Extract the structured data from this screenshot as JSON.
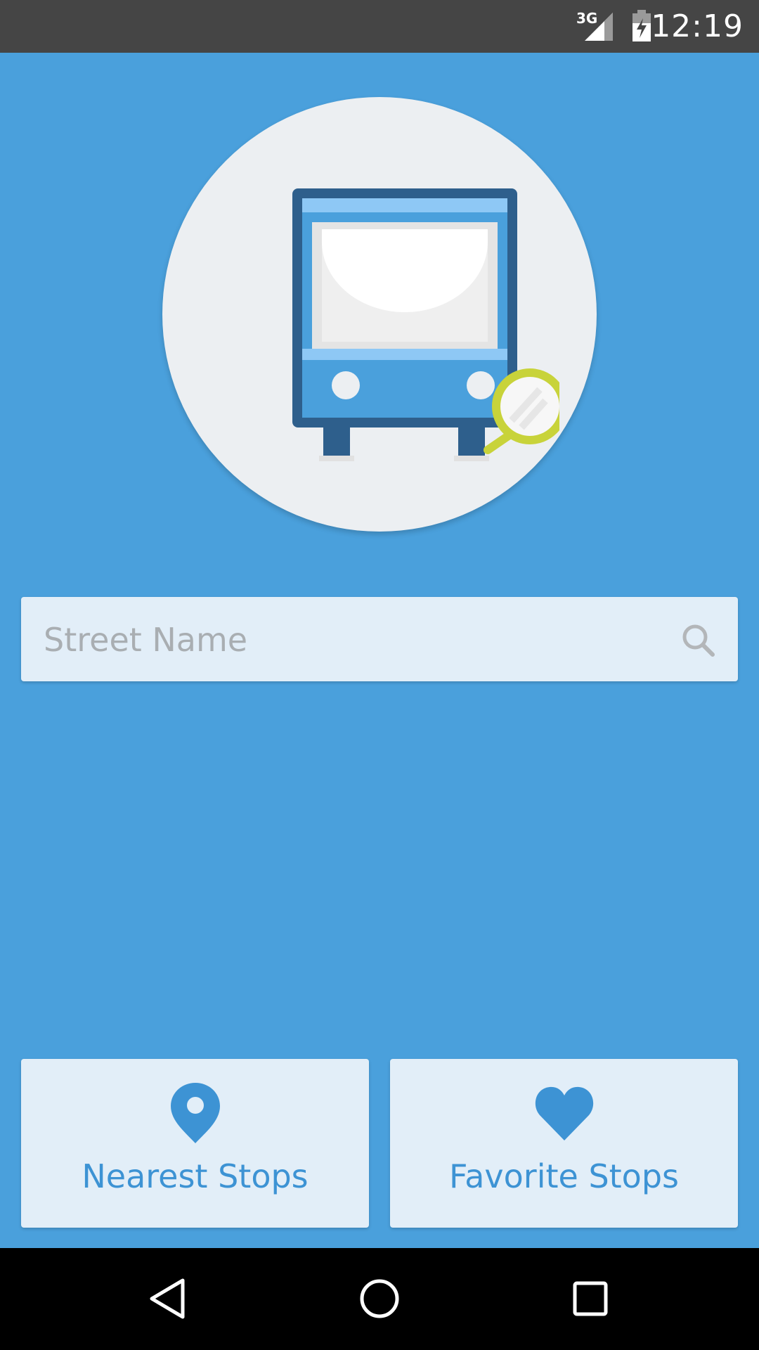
{
  "status_bar": {
    "network": "3G",
    "time": "12:19"
  },
  "logo": {
    "icon": "bus-with-magnifier-icon",
    "colors": {
      "circle": "#eceff2",
      "bus": "#4aa0dc",
      "bus_dark": "#2e5f8c",
      "magnifier": "#c8d33a"
    }
  },
  "search": {
    "placeholder": "Street Name",
    "value": "",
    "icon": "search-icon"
  },
  "actions": [
    {
      "label": "Nearest Stops",
      "icon": "location-pin-icon"
    },
    {
      "label": "Favorite Stops",
      "icon": "heart-icon"
    }
  ],
  "nav_bar": {
    "buttons": [
      "back-icon",
      "home-icon",
      "recent-apps-icon"
    ]
  },
  "colors": {
    "background": "#4aa0dc",
    "accent": "#3d93d4",
    "status_bar": "#454545",
    "nav_bar": "#000000"
  }
}
